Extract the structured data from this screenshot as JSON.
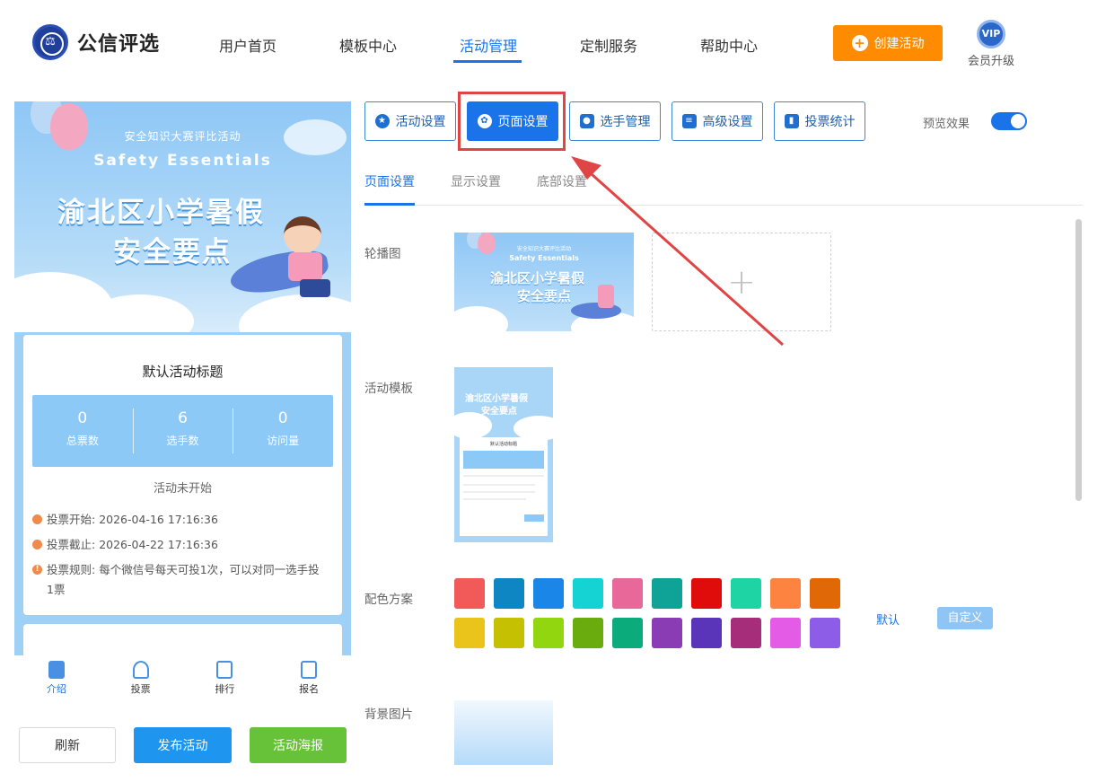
{
  "header": {
    "logo_text": "公信评选",
    "nav": [
      "用户首页",
      "模板中心",
      "活动管理",
      "定制服务",
      "帮助中心"
    ],
    "active_nav": "活动管理",
    "create_button": "创建活动",
    "vip_badge": "VIP",
    "vip_label": "会员升级"
  },
  "preview": {
    "banner_subtitle": "安全知识大赛评比活动",
    "banner_english": "Safety  Essentials",
    "banner_title_line1": "渝北区小学暑假",
    "banner_title_line2": "安全要点",
    "card_title": "默认活动标题",
    "stats": [
      {
        "value": "0",
        "label": "总票数"
      },
      {
        "value": "6",
        "label": "选手数"
      },
      {
        "value": "0",
        "label": "访问量"
      }
    ],
    "status": "活动未开始",
    "rules": [
      {
        "label": "投票开始:",
        "value": "2026-04-16 17:16:36"
      },
      {
        "label": "投票截止:",
        "value": "2026-04-22 17:16:36"
      },
      {
        "label": "投票规则:",
        "value": "每个微信号每天可投1次，可以对同一选手投1票"
      }
    ],
    "tabs": [
      "介绍",
      "投票",
      "排行",
      "报名"
    ],
    "active_tab": "介绍"
  },
  "actions": {
    "refresh": "刷新",
    "publish": "发布活动",
    "poster": "活动海报"
  },
  "settings": {
    "buttons": [
      "活动设置",
      "页面设置",
      "选手管理",
      "高级设置",
      "投票统计"
    ],
    "active_button": "页面设置",
    "preview_label": "预览效果",
    "preview_enabled": true,
    "subtabs": [
      "页面设置",
      "显示设置",
      "底部设置"
    ],
    "active_subtab": "页面设置",
    "fields": {
      "carousel": "轮播图",
      "template": "活动模板",
      "color_scheme": "配色方案",
      "background": "背景图片"
    },
    "add_symbol": "+",
    "scheme_default": "默认",
    "scheme_custom": "自定义",
    "colors": [
      "#f25a5a",
      "#0e86c4",
      "#1a87e8",
      "#16d3d3",
      "#e8689a",
      "#0fa296",
      "#e00c0c",
      "#1ed3a4",
      "#fd8440",
      "#e06806",
      "#eac41a",
      "#c5c002",
      "#92d610",
      "#6aab0d",
      "#0bab7c",
      "#8a3cb4",
      "#5a35b9",
      "#a62d79",
      "#e45ce6",
      "#8e5de8"
    ]
  },
  "colors": {
    "primary": "#1a73e8",
    "orange": "#ff8c00",
    "green": "#67c23a",
    "highlight": "#e04545"
  }
}
